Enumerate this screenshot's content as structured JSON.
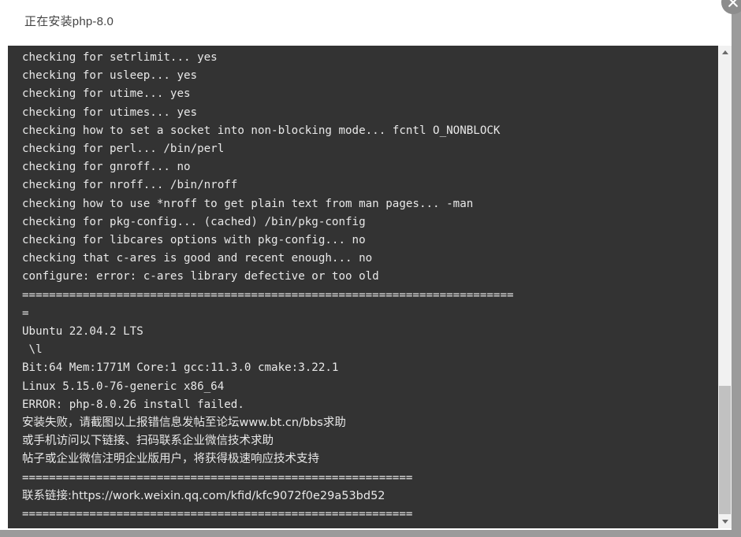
{
  "window": {
    "title": "正在安装php-8.0",
    "close_icon": "close-icon",
    "background_color": "#9b9b9b",
    "panel_color": "#ffffff"
  },
  "console": {
    "background_color": "#333333",
    "text_color": "#e8e8e8",
    "lines": [
      {
        "text": "checking for setrlimit... yes",
        "cjk": false
      },
      {
        "text": "checking for usleep... yes",
        "cjk": false
      },
      {
        "text": "checking for utime... yes",
        "cjk": false
      },
      {
        "text": "checking for utimes... yes",
        "cjk": false
      },
      {
        "text": "checking how to set a socket into non-blocking mode... fcntl O_NONBLOCK",
        "cjk": false
      },
      {
        "text": "checking for perl... /bin/perl",
        "cjk": false
      },
      {
        "text": "checking for gnroff... no",
        "cjk": false
      },
      {
        "text": "checking for nroff... /bin/nroff",
        "cjk": false
      },
      {
        "text": "checking how to use *nroff to get plain text from man pages... -man",
        "cjk": false
      },
      {
        "text": "checking for pkg-config... (cached) /bin/pkg-config",
        "cjk": false
      },
      {
        "text": "checking for libcares options with pkg-config... no",
        "cjk": false
      },
      {
        "text": "checking that c-ares is good and recent enough... no",
        "cjk": false
      },
      {
        "text": "configure: error: c-ares library defective or too old",
        "cjk": false
      },
      {
        "text": "=========================================================================",
        "cjk": false
      },
      {
        "text": "=",
        "cjk": false
      },
      {
        "text": "Ubuntu 22.04.2 LTS",
        "cjk": false
      },
      {
        "text": " \\l",
        "cjk": false
      },
      {
        "text": "Bit:64 Mem:1771M Core:1 gcc:11.3.0 cmake:3.22.1",
        "cjk": false
      },
      {
        "text": "Linux 5.15.0-76-generic x86_64",
        "cjk": false
      },
      {
        "text": "ERROR: php-8.0.26 install failed.",
        "cjk": false
      },
      {
        "text": "安装失败，请截图以上报错信息发帖至论坛www.bt.cn/bbs求助",
        "cjk": true
      },
      {
        "text": "或手机访问以下链接、扫码联系企业微信技术求助",
        "cjk": true
      },
      {
        "text": "帖子或企业微信注明企业版用户，将获得极速响应技术支持",
        "cjk": true
      },
      {
        "text": "==========================================================",
        "cjk": false
      },
      {
        "text": "联系链接:https://work.weixin.qq.com/kfid/kfc9072f0e29a53bd52",
        "cjk": true
      },
      {
        "text": "==========================================================",
        "cjk": false
      }
    ]
  },
  "scrollbar": {
    "up_arrow_icon": "chevron-up-icon",
    "down_arrow_icon": "chevron-down-icon",
    "thumb_color": "#c1c1c1",
    "track_color": "#f1f1f1"
  }
}
